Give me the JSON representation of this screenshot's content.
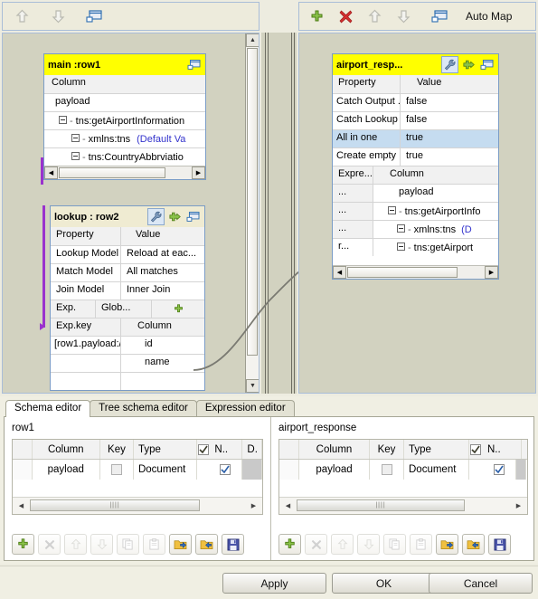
{
  "toolbars": {
    "left": [
      {
        "name": "move-up-icon",
        "glyph": "up-arrow",
        "disabled": true
      },
      {
        "name": "move-down-icon",
        "glyph": "down-arrow",
        "disabled": true
      },
      {
        "name": "minimize-all-icon",
        "glyph": "window",
        "disabled": false
      }
    ],
    "right": [
      {
        "name": "add-icon",
        "glyph": "plus",
        "disabled": false
      },
      {
        "name": "delete-icon",
        "glyph": "cross",
        "disabled": false
      },
      {
        "name": "move-up-icon",
        "glyph": "up-arrow",
        "disabled": true
      },
      {
        "name": "move-down-icon",
        "glyph": "down-arrow",
        "disabled": true
      },
      {
        "name": "auto-map-icon",
        "glyph": "window",
        "disabled": false
      }
    ],
    "auto_map_label": "Auto Map"
  },
  "left_canvas": {
    "main_box": {
      "title": "main :row1",
      "column_header": "Column",
      "rows": [
        {
          "label": "payload",
          "indent": 0,
          "expander": false,
          "extra": ""
        },
        {
          "label": "tns:getAirportInformation",
          "indent": 1,
          "expander": true,
          "extra": ""
        },
        {
          "label": "xmlns:tns",
          "indent": 2,
          "expander": true,
          "extra": "(Default Va"
        },
        {
          "label": "tns:CountryAbbrviatio",
          "indent": 2,
          "expander": true,
          "extra": ""
        }
      ]
    },
    "lookup_box": {
      "title": "lookup : row2",
      "property_header": "Property",
      "value_header": "Value",
      "properties": [
        {
          "name": "Lookup Model",
          "value": "Reload at eac..."
        },
        {
          "name": "Match Model",
          "value": "All matches"
        },
        {
          "name": "Join Model",
          "value": "Inner Join"
        }
      ],
      "exp_label": "Exp.",
      "glob_label": "Glob...",
      "expkey_header": "Exp.key",
      "column_header": "Column",
      "key_rows": [
        {
          "key": "[row1.payload:/",
          "column": "id"
        },
        {
          "key": "",
          "column": "name"
        }
      ]
    }
  },
  "right_canvas": {
    "response_box": {
      "title": "airport_resp...",
      "property_header": "Property",
      "value_header": "Value",
      "properties": [
        {
          "name": "Catch Output ...",
          "value": "false",
          "selected": false
        },
        {
          "name": "Catch Lookup ...",
          "value": "false",
          "selected": false
        },
        {
          "name": "All in one",
          "value": "true",
          "selected": true
        },
        {
          "name": "Create empty ...",
          "value": "true",
          "selected": false
        }
      ],
      "expr_header": "Expre...",
      "column_header": "Column",
      "rows": [
        {
          "expr": "...",
          "label": "payload",
          "indent": 0,
          "expander": false,
          "extra": ""
        },
        {
          "expr": "...",
          "label": "tns:getAirportInfo",
          "indent": 1,
          "expander": true,
          "extra": ""
        },
        {
          "expr": "...",
          "label": "xmlns:tns",
          "indent": 2,
          "expander": true,
          "extra": "(D"
        },
        {
          "expr": "r...",
          "label": "tns:getAirport",
          "indent": 2,
          "expander": true,
          "extra": ""
        }
      ]
    }
  },
  "schema_panel": {
    "tabs": [
      {
        "label": "Schema editor",
        "active": true
      },
      {
        "label": "Tree schema editor",
        "active": false
      },
      {
        "label": "Expression editor",
        "active": false
      }
    ],
    "left_table": {
      "title": "row1",
      "headers": [
        "",
        "Column",
        "Key",
        "Type",
        "✓",
        "N..",
        "D."
      ],
      "rows": [
        {
          "column": "payload",
          "key_checked": false,
          "type": "Document",
          "nullable": true
        }
      ]
    },
    "right_table": {
      "title": "airport_response",
      "headers": [
        "",
        "Column",
        "Key",
        "Type",
        "✓",
        "N.."
      ],
      "rows": [
        {
          "column": "payload",
          "key_checked": false,
          "type": "Document",
          "nullable": true
        }
      ]
    },
    "buttons": [
      {
        "name": "add-column-button",
        "glyph": "plus",
        "disabled": false
      },
      {
        "name": "remove-column-button",
        "glyph": "cross",
        "disabled": true
      },
      {
        "name": "move-up-button",
        "glyph": "up-arrow",
        "disabled": true
      },
      {
        "name": "move-down-button",
        "glyph": "down-arrow",
        "disabled": true
      },
      {
        "name": "copy-button",
        "glyph": "copy",
        "disabled": true
      },
      {
        "name": "paste-button",
        "glyph": "paste",
        "disabled": true
      },
      {
        "name": "import-schema-button",
        "glyph": "folder-export",
        "disabled": false
      },
      {
        "name": "export-schema-button",
        "glyph": "folder-import",
        "disabled": false
      },
      {
        "name": "save-schema-button",
        "glyph": "floppy",
        "disabled": false
      }
    ]
  },
  "dialog_buttons": {
    "apply": "Apply",
    "ok": "OK",
    "cancel": "Cancel"
  },
  "colors": {
    "title_yellow": "#ffff00",
    "selection_blue": "#c5dcf0",
    "canvas_gray": "#d2d2c0",
    "link_purple": "#9a32cd",
    "default_value_blue": "#3333cc"
  }
}
